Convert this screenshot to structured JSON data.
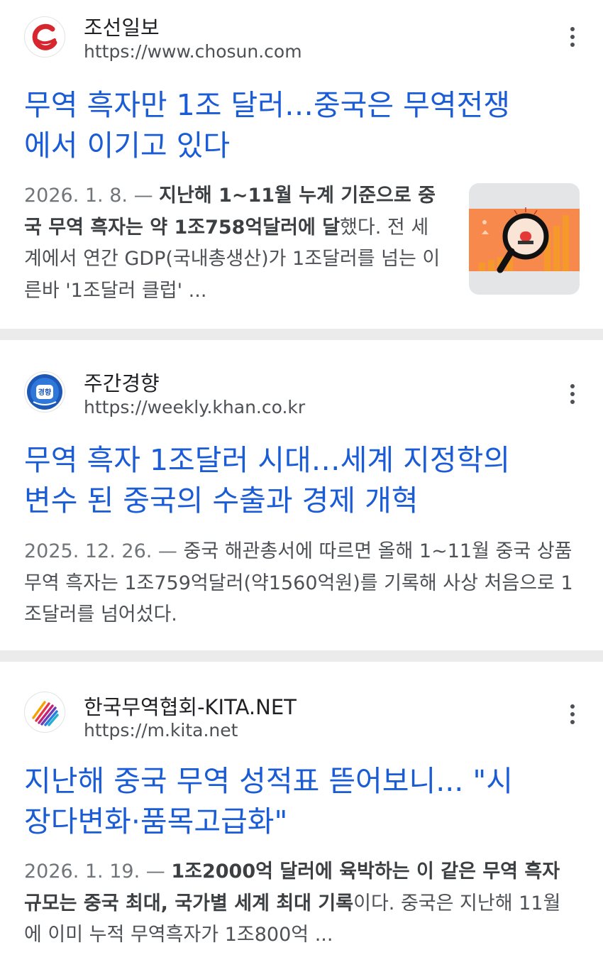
{
  "results": [
    {
      "source": "조선일보",
      "url": "https://www.chosun.com",
      "title_line1": "무역 흑자만 1조 달러…중국은 무역전쟁",
      "title_line2": "에서 이기고 있다",
      "date": "2026. 1. 8. — ",
      "snippet_bold": "지난해 1~11월 누계 기준으로 중국 무역 흑자는 약 1조758억달러에 달",
      "snippet_rest": "했다. 전 세계에서 연간 GDP(국내총생산)가 1조달러를 넘는 이른바 '1조달러 클럽' ...",
      "favicon_icon": "chosun-logo-icon",
      "thumbnail": "trade-surplus-alarm-chart-image"
    },
    {
      "source": "주간경향",
      "url": "https://weekly.khan.co.kr",
      "title_line1": "무역 흑자 1조달러 시대…세계 지정학의",
      "title_line2": "변수 된 중국의 수출과 경제 개혁",
      "date": "2025. 12. 26. — ",
      "snippet_rest": "중국 해관총서에 따르면 올해 1~11월 중국 상품 무역 흑자는 1조759억달러(약1560억원)를 기록해 사상 처음으로 1조달러를 넘어섰다.",
      "favicon_icon": "kyunghyang-logo-icon",
      "favicon_text": "경향"
    },
    {
      "source": "한국무역협회-KITA.NET",
      "url": "https://m.kita.net",
      "title_line1": "지난해 중국 무역 성적표 뜯어보니... \"시",
      "title_line2": "장다변화·품목고급화\"",
      "date": "2026. 1. 19. — ",
      "snippet_bold": "1조2000억 달러에 육박하는 이 같은 무역 흑자 규모는 중국 최대, 국가별 세계 최대 기록",
      "snippet_rest": "이다. 중국은 지난해 11월에 이미 누적 무역흑자가 1조800억 ...",
      "favicon_icon": "kita-logo-icon"
    }
  ],
  "colors": {
    "title_link": "#1a5bd6",
    "separator": "#ebebeb",
    "thumbnail_orange": "#f7894d"
  }
}
